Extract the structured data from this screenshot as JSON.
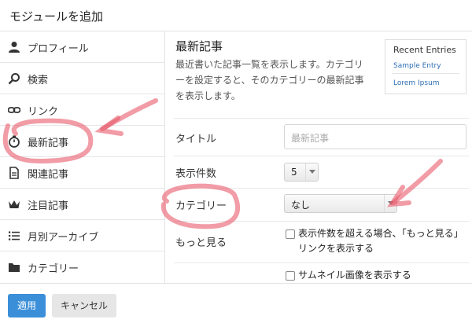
{
  "dialog": {
    "title": "モジュールを追加"
  },
  "sidebar": {
    "items": [
      {
        "label": "プロフィール",
        "icon": "user-icon"
      },
      {
        "label": "検索",
        "icon": "search-icon"
      },
      {
        "label": "リンク",
        "icon": "link-icon"
      },
      {
        "label": "最新記事",
        "icon": "stopwatch-icon"
      },
      {
        "label": "関連記事",
        "icon": "document-icon"
      },
      {
        "label": "注目記事",
        "icon": "crown-icon"
      },
      {
        "label": "月別アーカイブ",
        "icon": "list-icon"
      },
      {
        "label": "カテゴリー",
        "icon": "folder-icon"
      }
    ]
  },
  "module": {
    "title": "最新記事",
    "description": "最近書いた記事一覧を表示します。カテゴリーを設定すると、そのカテゴリーの最新記事を表示します。",
    "preview": {
      "heading": "Recent Entries",
      "links": [
        "Sample Entry",
        "Lorem Ipsum"
      ]
    }
  },
  "form": {
    "title_label": "タイトル",
    "title_placeholder": "最新記事",
    "count_label": "表示件数",
    "count_value": "5",
    "category_label": "カテゴリー",
    "category_value": "なし",
    "more_label": "もっと見る",
    "more_checkbox": "表示件数を超える場合、「もっと見る」リンクを表示する",
    "thumb_checkbox": "サムネイル画像を表示する"
  },
  "footer": {
    "apply": "適用",
    "cancel": "キャンセル"
  },
  "colors": {
    "accent": "#3b8fd9",
    "annotation": "#e85a6a"
  }
}
